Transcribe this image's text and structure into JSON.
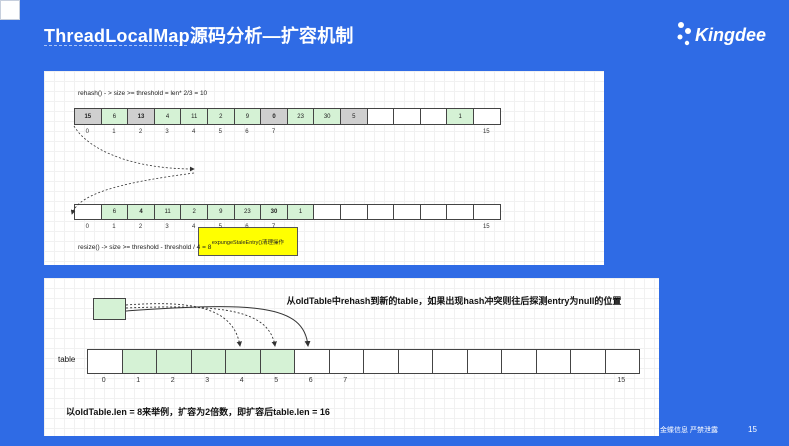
{
  "header": {
    "title": "ThreadLocalMap源码分析—扩容机制",
    "logo_text": "Kingdee"
  },
  "diagram1": {
    "rehash_caption": "rehash() - > size >= threshold = len* 2/3 = 10",
    "row1": [
      {
        "v": "15",
        "c": "gray"
      },
      {
        "v": "6",
        "c": "green"
      },
      {
        "v": "13",
        "c": "gray"
      },
      {
        "v": "4",
        "c": "green"
      },
      {
        "v": "11",
        "c": "green"
      },
      {
        "v": "2",
        "c": "green"
      },
      {
        "v": "9",
        "c": "green"
      },
      {
        "v": "0",
        "c": "gray"
      },
      {
        "v": "23",
        "c": "green"
      },
      {
        "v": "30",
        "c": "green"
      },
      {
        "v": "5",
        "c": "gray"
      },
      {
        "v": "",
        "c": "white"
      },
      {
        "v": "",
        "c": "white"
      },
      {
        "v": "",
        "c": "white"
      },
      {
        "v": "1",
        "c": "green"
      },
      {
        "v": "",
        "c": "white"
      }
    ],
    "row1_indices": [
      "0",
      "1",
      "2",
      "3",
      "4",
      "5",
      "6",
      "7",
      "15"
    ],
    "note": "expungeStaleEntry()清理操作",
    "row2": [
      {
        "v": "",
        "c": "white"
      },
      {
        "v": "6",
        "c": "green"
      },
      {
        "v": "4",
        "c": "green"
      },
      {
        "v": "11",
        "c": "green"
      },
      {
        "v": "2",
        "c": "green"
      },
      {
        "v": "9",
        "c": "green"
      },
      {
        "v": "23",
        "c": "green"
      },
      {
        "v": "30",
        "c": "green"
      },
      {
        "v": "1",
        "c": "green"
      },
      {
        "v": "",
        "c": "white"
      },
      {
        "v": "",
        "c": "white"
      },
      {
        "v": "",
        "c": "white"
      },
      {
        "v": "",
        "c": "white"
      },
      {
        "v": "",
        "c": "white"
      },
      {
        "v": "",
        "c": "white"
      },
      {
        "v": "",
        "c": "white"
      }
    ],
    "row2_indices": [
      "0",
      "1",
      "2",
      "3",
      "4",
      "5",
      "6",
      "7",
      "15"
    ],
    "resize_caption": "resize() -> size >= threshold - threshold / 4 = 8"
  },
  "diagram2": {
    "hint": "从oldTable中rehash到新的table，如果出现hash冲突则往后探测entry为null的位置",
    "table_label": "table",
    "cells": [
      "white",
      "green",
      "green",
      "green",
      "green",
      "green",
      "white",
      "white",
      "white",
      "white",
      "white",
      "white",
      "white",
      "white",
      "white",
      "white"
    ],
    "indices": [
      "0",
      "1",
      "2",
      "3",
      "4",
      "5",
      "6",
      "7",
      "15"
    ],
    "caption": "以oldTable.len = 8来举例，扩容为2倍数，即扩容后table.len = 16"
  },
  "footer": {
    "text": "金蝶信息 严禁泄露",
    "page": "15"
  },
  "colors": {
    "brand_blue": "#2f6be5",
    "cell_green": "#d5f2d5",
    "cell_gray": "#cfcfcf",
    "note_yellow": "#ffff00"
  }
}
